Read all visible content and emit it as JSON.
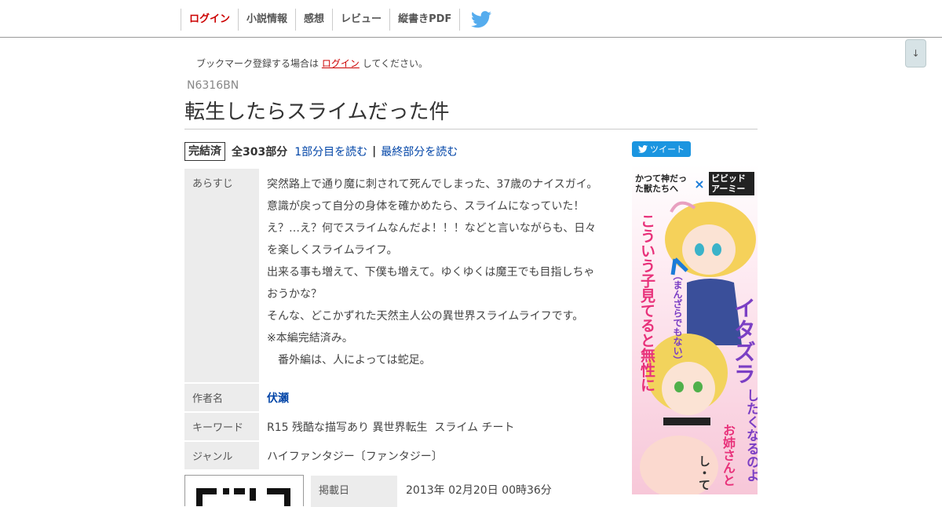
{
  "nav": {
    "items": [
      "ログイン",
      "小説情報",
      "感想",
      "レビュー",
      "縦書きPDF"
    ],
    "twitter_icon": "twitter-bird-icon"
  },
  "scroll_button": "↓",
  "bookmark_note": {
    "before": "ブックマーク登録する場合は",
    "link": "ログイン",
    "after": "してください。"
  },
  "ncode": "N6316BN",
  "title": "転生したらスライムだった件",
  "status": {
    "badge": "完結済",
    "total": "全303部分",
    "first_link": "1部分目を読む",
    "separator": "|",
    "last_link": "最終部分を読む"
  },
  "tweet": {
    "label": "ツイート",
    "icon": "twitter-bird-icon"
  },
  "info": {
    "synopsis_label": "あらすじ",
    "synopsis_lines": [
      "突然路上で通り魔に刺されて死んでしまった、37歳のナイスガイ。",
      "意識が戻って自分の身体を確かめたら、スライムになっていた！",
      "え？…え？何でスライムなんだよ！！！などと言いながらも、日々",
      "を楽しくスライムライフ。",
      "出来る事も増えて、下僕も増えて。ゆくゆくは魔王でも目指しちゃ",
      "おうかな？",
      "そんな、どこかずれた天然主人公の異世界スライムライフです。",
      "※本編完結済み。",
      "　番外編は、人によっては蛇足。"
    ],
    "author_label": "作者名",
    "author": "伏瀬",
    "keyword_label": "キーワード",
    "keywords": "R15 残酷な描写あり 異世界転生  スライム チート",
    "genre_label": "ジャンル",
    "genre": "ハイファンタジー〔ファンタジー〕",
    "published_label": "掲載日",
    "published": "2013年 02月20日 00時36分"
  },
  "ad": {
    "title_left": "かつて神だった獣たちへ",
    "cross": "×",
    "title_right": "ビビッドアーミー",
    "copy1": "こういう子見てると無性に",
    "copy2": "（まんざらでもない）",
    "copy3": "イタズラ",
    "copy4": "したくなるのよ",
    "copy5": "お姉さんと",
    "copy6": "し・て・",
    "colors": {
      "pink": "#e8317a",
      "purple": "#7b3fc4",
      "blue": "#1a7bd8"
    }
  }
}
